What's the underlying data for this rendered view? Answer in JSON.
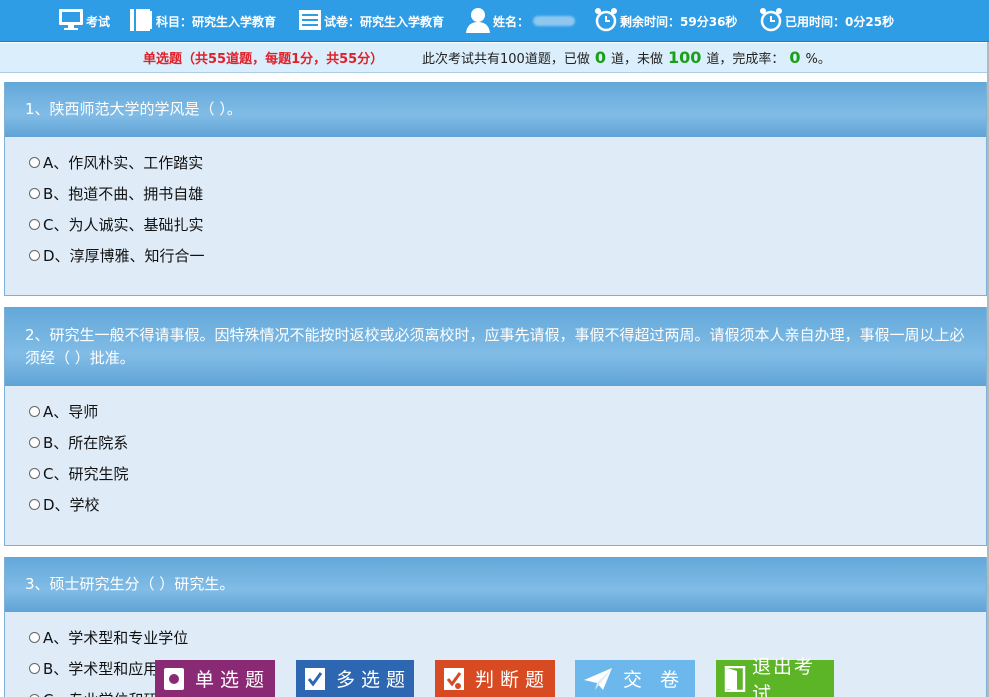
{
  "topbar": {
    "exam_label": "考试",
    "subject_label": "科目：",
    "subject_value": "研究生入学教育",
    "paper_label": "试卷：",
    "paper_value": "研究生入学教育",
    "name_label": "姓名：",
    "remaining_label": "剩余时间：",
    "remaining_value": "59分36秒",
    "used_label": "已用时间：",
    "used_value": "0分25秒"
  },
  "infobar": {
    "section": "单选题（共55道题，每题1分，共55分）",
    "text_before_done": "此次考试共有100道题，已做",
    "done_count": "0",
    "text_before_undone": "道，未做",
    "undone_count": "100",
    "text_before_rate": "道，完成率：",
    "rate": "0",
    "rate_suffix": "%。"
  },
  "questions": [
    {
      "title": "1、陕西师范大学的学风是（  ）。",
      "options": [
        "A、作风朴实、工作踏实",
        "B、抱道不曲、拥书自雄",
        "C、为人诚实、基础扎实",
        "D、淳厚博雅、知行合一"
      ]
    },
    {
      "title": "2、研究生一般不得请事假。因特殊情况不能按时返校或必须离校时，应事先请假，事假不得超过两周。请假须本人亲自办理，事假一周以上必须经（  ）批准。",
      "options": [
        "A、导师",
        "B、所在院系",
        "C、研究生院",
        "D、学校"
      ]
    },
    {
      "title": "3、硕士研究生分（  ）研究生。",
      "options": [
        "A、学术型和专业学位",
        "B、学术型和应用型",
        "C、专业学位和研究型"
      ]
    }
  ],
  "buttons": {
    "single": "单选题",
    "multi": "多选题",
    "judge": "判断题",
    "submit": "交 卷",
    "exit": "退出考试"
  },
  "colors": {
    "topbar": "#2f9de6",
    "section_red": "#e0202a",
    "count_green": "#18a018",
    "btn_single": "#8b2a74",
    "btn_multi": "#2d67b2",
    "btn_judge": "#d84a22",
    "btn_submit": "#6cb8ec",
    "btn_exit": "#5bb526"
  },
  "icons": [
    "computer-icon",
    "book-icon",
    "paper-icon",
    "user-icon",
    "alarm-clock-icon",
    "alarm-clock-icon",
    "checkbox-icon",
    "checkmark-icon",
    "judge-icon",
    "paper-plane-icon",
    "exit-door-icon"
  ]
}
